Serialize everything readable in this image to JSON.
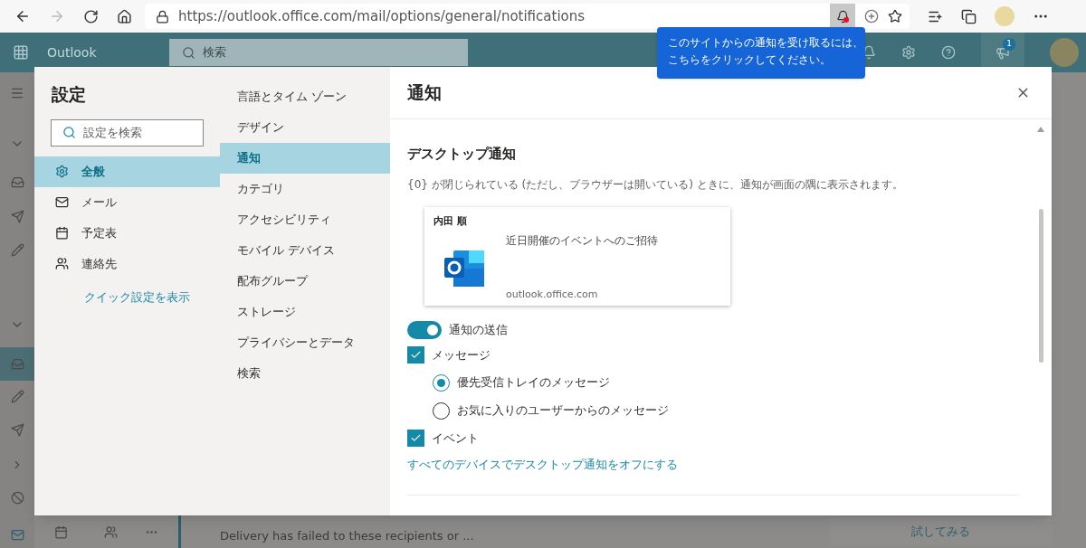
{
  "browser": {
    "url": "https://outlook.office.com/mail/options/general/notifications",
    "tooltip": [
      "このサイトからの通知を受け取るには、",
      "こちらをクリックしてください。"
    ]
  },
  "header": {
    "app_name": "Outlook",
    "search_placeholder": "検索",
    "badge": "1"
  },
  "background": {
    "message_preview": "Delivery has failed to these recipients or ...",
    "try_button": "試してみる"
  },
  "settings": {
    "title": "設定",
    "search_placeholder": "設定を検索",
    "categories": [
      {
        "label": "全般",
        "selected": true
      },
      {
        "label": "メール",
        "selected": false
      },
      {
        "label": "予定表",
        "selected": false
      },
      {
        "label": "連絡先",
        "selected": false
      }
    ],
    "quick_settings_link": "クイック設定を表示",
    "subcategories": [
      {
        "label": "言語とタイム ゾーン",
        "selected": false
      },
      {
        "label": "デザイン",
        "selected": false
      },
      {
        "label": "通知",
        "selected": true
      },
      {
        "label": "カテゴリ",
        "selected": false
      },
      {
        "label": "アクセシビリティ",
        "selected": false
      },
      {
        "label": "モバイル デバイス",
        "selected": false
      },
      {
        "label": "配布グループ",
        "selected": false
      },
      {
        "label": "ストレージ",
        "selected": false
      },
      {
        "label": "プライバシーとデータ",
        "selected": false
      },
      {
        "label": "検索",
        "selected": false
      }
    ],
    "panel": {
      "title": "通知",
      "section_heading": "デスクトップ通知",
      "description": "{0} が閉じられている (ただし、ブラウザーは開いている) ときに、通知が画面の隅に表示されます。",
      "preview": {
        "sender": "内田 順",
        "subject": "近日開催のイベントへのご招待",
        "domain": "outlook.office.com"
      },
      "options": [
        {
          "kind": "toggle",
          "label": "通知の送信",
          "on": true
        },
        {
          "kind": "checkbox",
          "label": "メッセージ",
          "checked": true
        },
        {
          "kind": "radio",
          "label": "優先受信トレイのメッセージ",
          "selected": true
        },
        {
          "kind": "radio",
          "label": "お気に入りのユーザーからのメッセージ",
          "selected": false
        },
        {
          "kind": "checkbox",
          "label": "イベント",
          "checked": true
        }
      ],
      "link": "すべてのデバイスでデスクトップ通知をオフにする"
    }
  }
}
